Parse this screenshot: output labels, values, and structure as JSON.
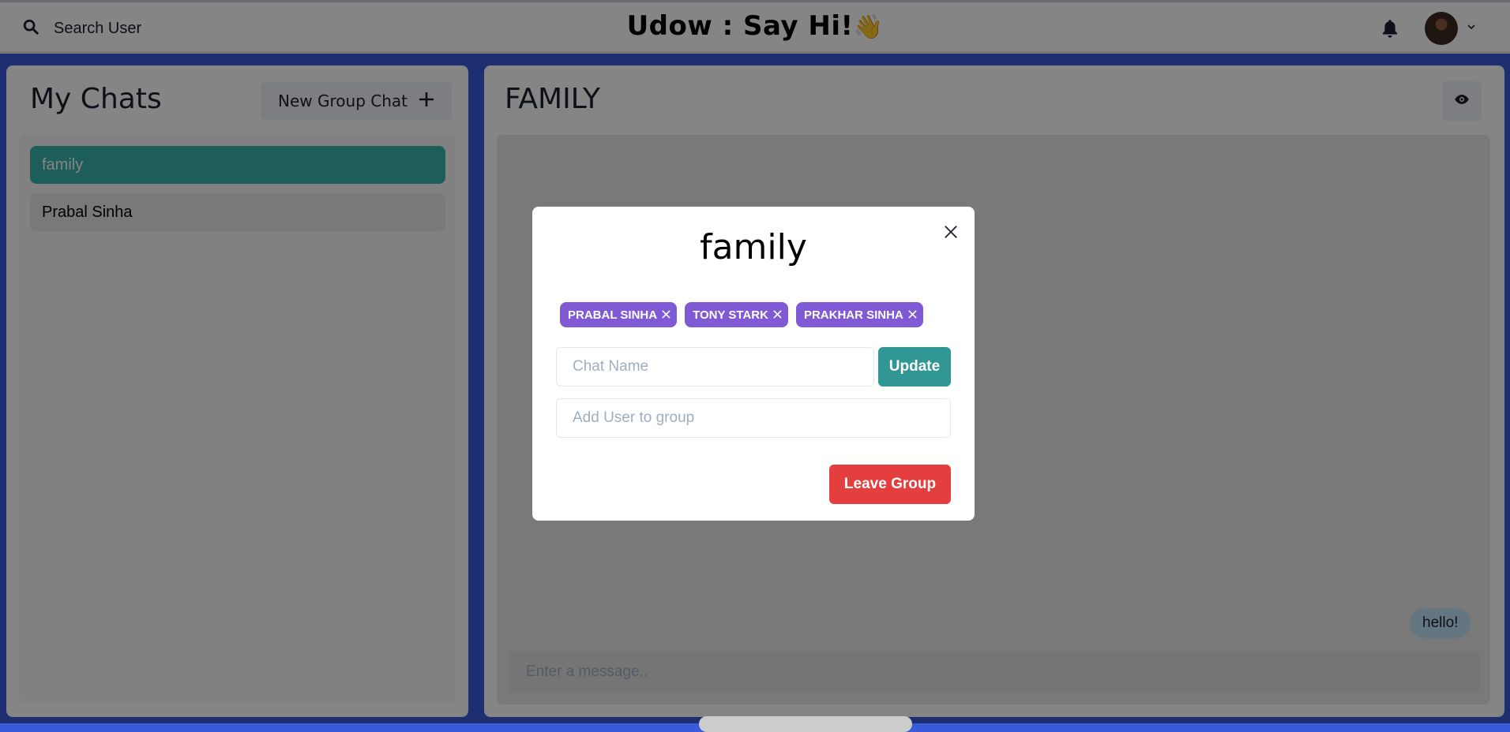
{
  "header": {
    "search_label": "Search User",
    "app_title": "Udow : Say Hi!",
    "title_emoji": "👋"
  },
  "left": {
    "title": "My Chats",
    "new_group_label": "New Group Chat",
    "chats": [
      {
        "name": "family",
        "active": true
      },
      {
        "name": "Prabal Sinha",
        "active": false
      }
    ]
  },
  "right": {
    "chat_title": "FAMILY",
    "messages": [
      {
        "text": "hello!",
        "from_me": true
      }
    ],
    "message_placeholder": "Enter a message.."
  },
  "modal": {
    "title": "family",
    "members": [
      "PRABAL SINHA",
      "TONY STARK",
      "PRAKHAR SINHA"
    ],
    "chat_name_placeholder": "Chat Name",
    "update_label": "Update",
    "add_user_placeholder": "Add User to group",
    "leave_label": "Leave Group"
  },
  "colors": {
    "background": "#3a5bd9",
    "active_chat": "#38b2ac",
    "member_tag": "#805ad5",
    "update_button": "#319795",
    "leave_button": "#e53e3e",
    "message_bubble": "#bee3f8"
  },
  "icons": {
    "search": "search-icon",
    "bell": "bell-icon",
    "avatar": "user-avatar",
    "caret": "chevron-down-icon",
    "add": "plus-icon",
    "view": "eye-icon",
    "close": "close-icon"
  }
}
